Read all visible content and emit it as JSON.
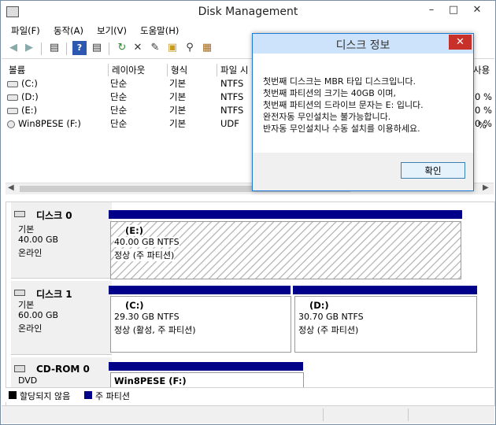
{
  "window": {
    "title": "Disk Management"
  },
  "menu": [
    "파일(F)",
    "동작(A)",
    "보기(V)",
    "도움말(H)"
  ],
  "volume_list": {
    "headers": [
      "볼륨",
      "레이아웃",
      "형식",
      "파일 시"
    ],
    "right_header_fragment": "사용",
    "rows": [
      {
        "volume": "(C:)",
        "layout": "단순",
        "type": "기본",
        "fs": "NTFS",
        "pct": "0 %"
      },
      {
        "volume": "(D:)",
        "layout": "단순",
        "type": "기본",
        "fs": "NTFS",
        "pct": "0 %"
      },
      {
        "volume": "(E:)",
        "layout": "단순",
        "type": "기본",
        "fs": "NTFS",
        "pct": "0 %"
      },
      {
        "volume": "Win8PESE (F:)",
        "layout": "단순",
        "type": "기본",
        "fs": "UDF",
        "pct": "%"
      }
    ]
  },
  "disks": [
    {
      "name": "디스크 0",
      "kind": "기본",
      "size": "40.00 GB",
      "state": "온라인",
      "partitions": [
        {
          "label": "(E:)",
          "size": "40.00 GB NTFS",
          "status": "정상 (주 파티션)"
        }
      ]
    },
    {
      "name": "디스크 1",
      "kind": "기본",
      "size": "60.00 GB",
      "state": "온라인",
      "partitions": [
        {
          "label": "(C:)",
          "size": "29.30 GB NTFS",
          "status": "정상 (활성, 주 파티션)"
        },
        {
          "label": "(D:)",
          "size": "30.70 GB NTFS",
          "status": "정상 (주 파티션)"
        }
      ]
    },
    {
      "name": "CD-ROM 0",
      "kind": "DVD",
      "partitions": [
        {
          "label": "Win8PESE  (F:)"
        }
      ]
    }
  ],
  "legend": {
    "unallocated": "할당되지 않음",
    "primary": "주 파티션"
  },
  "dialog": {
    "title": "디스크 정보",
    "lines": [
      "첫번째 디스크는 MBR 타입 디스크입니다.",
      "첫번째 파티션의 크기는 40GB 이며,",
      "첫번째 파티션의 드라이브 문자는 E: 입니다.",
      "완전자동 무인설치는 불가능합니다.",
      "반자동 무인설치나 수동 설치를 이용하세요."
    ],
    "ok_label": "확인",
    "close_glyph": "✕"
  },
  "colors": {
    "partition_bar": "#000088",
    "dialog_close": "#c7312a",
    "dialog_title_bg": "#cde3fb"
  },
  "icons": [
    "app-icon",
    "back-arrow-icon",
    "forward-arrow-icon",
    "console-icon",
    "help-icon",
    "list-icon",
    "refresh-icon",
    "delete-icon",
    "properties-icon",
    "open-icon",
    "search-icon",
    "export-icon",
    "disk-drive-icon",
    "cdrom-icon"
  ]
}
